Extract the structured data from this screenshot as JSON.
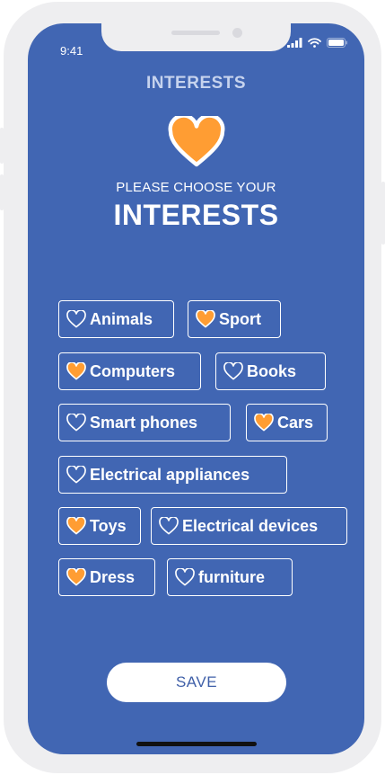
{
  "status_bar": {
    "time": "9:41"
  },
  "header": {
    "title": "INTERESTS"
  },
  "prompt": {
    "subtitle": "PLEASE CHOOSE YOUR",
    "headline": "INTERESTS"
  },
  "interests": [
    {
      "label": "Animals",
      "selected": false
    },
    {
      "label": "Sport",
      "selected": true
    },
    {
      "label": "Computers",
      "selected": true
    },
    {
      "label": "Books",
      "selected": false
    },
    {
      "label": "Smart phones",
      "selected": false
    },
    {
      "label": "Cars",
      "selected": true
    },
    {
      "label": "Electrical appliances",
      "selected": false
    },
    {
      "label": "Toys",
      "selected": true
    },
    {
      "label": "Electrical devices",
      "selected": false
    },
    {
      "label": "Dress",
      "selected": true
    },
    {
      "label": "furniture",
      "selected": false
    }
  ],
  "actions": {
    "save_label": "SAVE"
  },
  "colors": {
    "background": "#4166b3",
    "accent": "#ff9d33",
    "text": "#ffffff"
  },
  "icons": {
    "selected": "heart-filled-icon",
    "unselected": "heart-outline-icon"
  }
}
